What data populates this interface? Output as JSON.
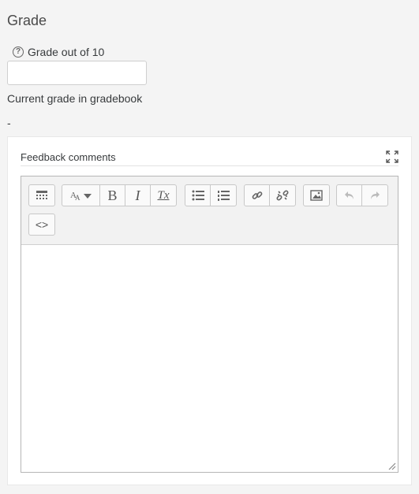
{
  "section": {
    "title": "Grade"
  },
  "grade": {
    "label": "Grade out of 10",
    "help_glyph": "?",
    "input_value": "",
    "input_placeholder": ""
  },
  "gradebook": {
    "label": "Current grade in gradebook",
    "value": "-"
  },
  "feedback": {
    "title": "Feedback comments",
    "toolbar": {
      "groups": [
        [
          "show-more-buttons-icon"
        ],
        [
          "font-style-icon",
          "bold-icon",
          "italic-icon",
          "clear-formatting-icon"
        ],
        [
          "unordered-list-icon",
          "ordered-list-icon"
        ],
        [
          "link-icon",
          "unlink-icon"
        ],
        [
          "image-icon"
        ],
        [
          "undo-icon",
          "redo-icon"
        ],
        [
          "html-icon"
        ]
      ],
      "bold_glyph": "B",
      "italic_glyph": "I",
      "clear_glyph": "Tx",
      "html_glyph": "<>",
      "font_glyph": "A"
    },
    "content": ""
  }
}
